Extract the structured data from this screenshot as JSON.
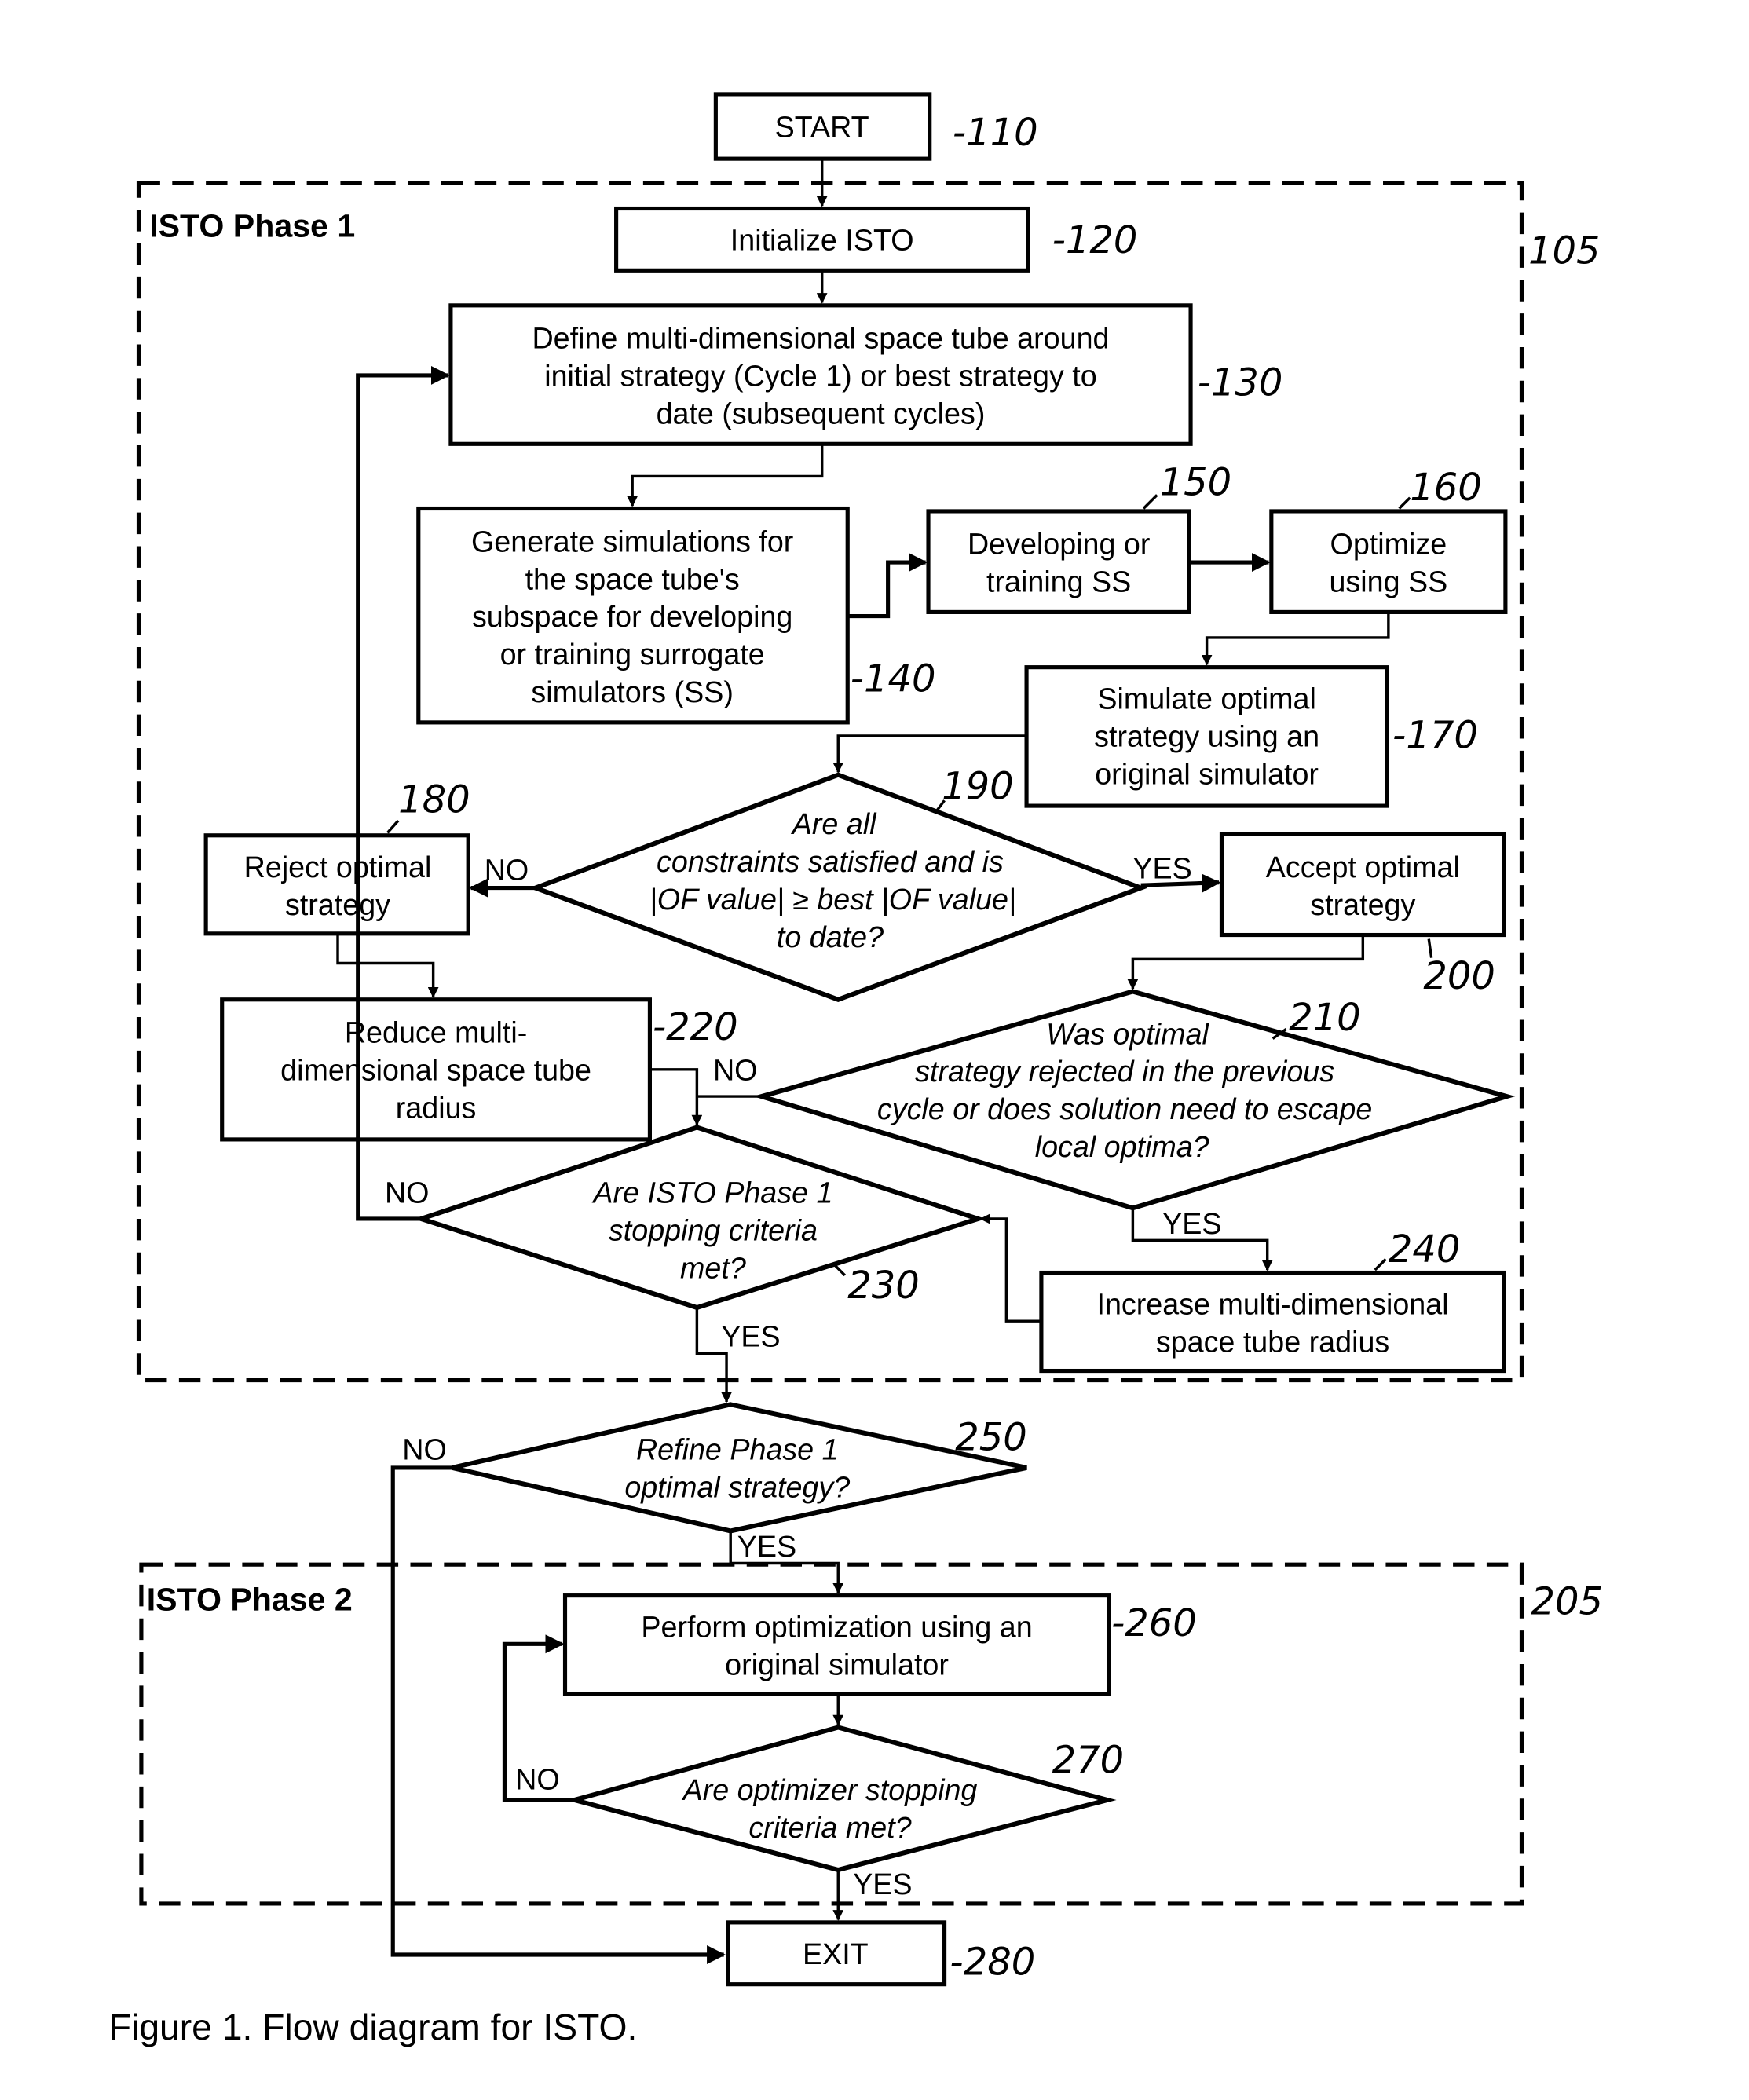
{
  "figure": {
    "caption": "Figure 1.  Flow diagram for ISTO.",
    "phase1_label": "ISTO Phase 1",
    "phase1_ref": "105",
    "phase2_label": "ISTO Phase 2",
    "phase2_ref": "205"
  },
  "nodes": {
    "start": {
      "lines": [
        "START"
      ],
      "ref": "-110"
    },
    "initialize": {
      "lines": [
        "Initialize ISTO"
      ],
      "ref": "-120"
    },
    "define_tube": {
      "lines": [
        "Define multi-dimensional space tube around",
        "initial strategy (Cycle 1) or best strategy to",
        "date (subsequent cycles)"
      ],
      "ref": "-130"
    },
    "generate_sims": {
      "lines": [
        "Generate simulations for",
        "the space tube's",
        "subspace for developing",
        "or training surrogate",
        "simulators (SS)"
      ],
      "ref": "-140"
    },
    "develop_ss": {
      "lines": [
        "Developing or",
        "training SS"
      ],
      "ref": "150"
    },
    "optimize_ss": {
      "lines": [
        "Optimize",
        "using SS"
      ],
      "ref": "160"
    },
    "simulate_optimal": {
      "lines": [
        "Simulate optimal",
        "strategy using an",
        "original simulator"
      ],
      "ref": "-170"
    },
    "reject": {
      "lines": [
        "Reject optimal",
        "strategy"
      ],
      "ref": "180"
    },
    "constraints_decision": {
      "lines": [
        "Are all",
        "constraints satisfied and is",
        "|OF value| ≥  best  |OF value|",
        "to date?"
      ],
      "ref": "190"
    },
    "accept": {
      "lines": [
        "Accept optimal",
        "strategy"
      ],
      "ref": "200"
    },
    "rejected_decision": {
      "lines": [
        "Was  optimal",
        "strategy rejected  in the previous",
        "cycle or does solution need to escape",
        "local optima?"
      ],
      "ref": "210"
    },
    "reduce_radius": {
      "lines": [
        "Reduce multi-",
        "dimensional space tube",
        "radius"
      ],
      "ref": "-220"
    },
    "phase1_stop_decision": {
      "lines": [
        "Are ISTO Phase 1",
        "stopping criteria",
        "met?"
      ],
      "ref": "230"
    },
    "increase_radius": {
      "lines": [
        "Increase multi-dimensional",
        "space tube radius"
      ],
      "ref": "240"
    },
    "refine_decision": {
      "lines": [
        "Refine Phase 1",
        "optimal strategy?"
      ],
      "ref": "250"
    },
    "perform_opt": {
      "lines": [
        "Perform optimization using an",
        "original simulator"
      ],
      "ref": "-260"
    },
    "optimizer_stop_decision": {
      "lines": [
        "Are optimizer stopping",
        "criteria met?"
      ],
      "ref": "270"
    },
    "exit": {
      "lines": [
        "EXIT"
      ],
      "ref": "-280"
    }
  },
  "edge_labels": {
    "no_190": "NO",
    "yes_190": "YES",
    "no_210": "NO",
    "yes_210": "YES",
    "no_230": "NO",
    "yes_230": "YES",
    "no_250": "NO",
    "yes_250": "YES",
    "no_270": "NO",
    "yes_270": "YES"
  }
}
